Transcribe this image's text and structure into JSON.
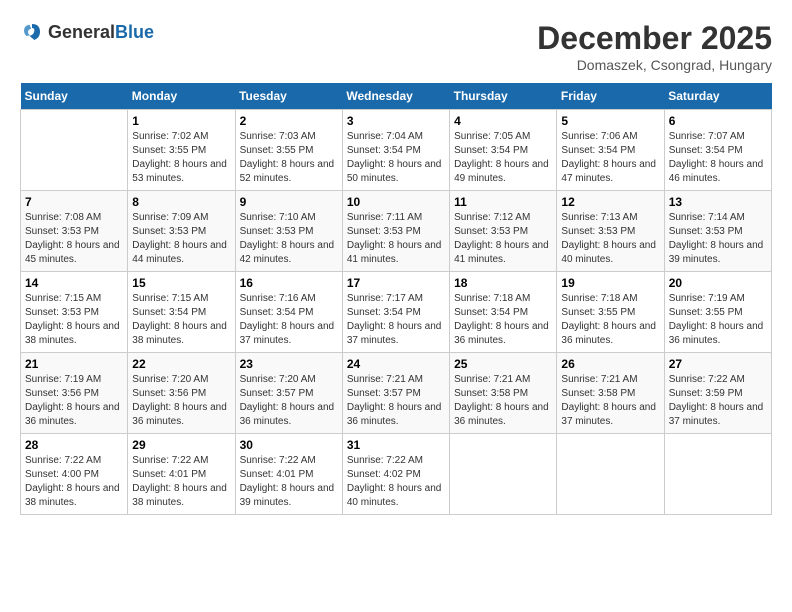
{
  "header": {
    "logo_general": "General",
    "logo_blue": "Blue",
    "month_title": "December 2025",
    "location": "Domaszek, Csongrad, Hungary"
  },
  "days_of_week": [
    "Sunday",
    "Monday",
    "Tuesday",
    "Wednesday",
    "Thursday",
    "Friday",
    "Saturday"
  ],
  "weeks": [
    [
      {
        "day": "",
        "sunrise": "",
        "sunset": "",
        "daylight": ""
      },
      {
        "day": "1",
        "sunrise": "Sunrise: 7:02 AM",
        "sunset": "Sunset: 3:55 PM",
        "daylight": "Daylight: 8 hours and 53 minutes."
      },
      {
        "day": "2",
        "sunrise": "Sunrise: 7:03 AM",
        "sunset": "Sunset: 3:55 PM",
        "daylight": "Daylight: 8 hours and 52 minutes."
      },
      {
        "day": "3",
        "sunrise": "Sunrise: 7:04 AM",
        "sunset": "Sunset: 3:54 PM",
        "daylight": "Daylight: 8 hours and 50 minutes."
      },
      {
        "day": "4",
        "sunrise": "Sunrise: 7:05 AM",
        "sunset": "Sunset: 3:54 PM",
        "daylight": "Daylight: 8 hours and 49 minutes."
      },
      {
        "day": "5",
        "sunrise": "Sunrise: 7:06 AM",
        "sunset": "Sunset: 3:54 PM",
        "daylight": "Daylight: 8 hours and 47 minutes."
      },
      {
        "day": "6",
        "sunrise": "Sunrise: 7:07 AM",
        "sunset": "Sunset: 3:54 PM",
        "daylight": "Daylight: 8 hours and 46 minutes."
      }
    ],
    [
      {
        "day": "7",
        "sunrise": "Sunrise: 7:08 AM",
        "sunset": "Sunset: 3:53 PM",
        "daylight": "Daylight: 8 hours and 45 minutes."
      },
      {
        "day": "8",
        "sunrise": "Sunrise: 7:09 AM",
        "sunset": "Sunset: 3:53 PM",
        "daylight": "Daylight: 8 hours and 44 minutes."
      },
      {
        "day": "9",
        "sunrise": "Sunrise: 7:10 AM",
        "sunset": "Sunset: 3:53 PM",
        "daylight": "Daylight: 8 hours and 42 minutes."
      },
      {
        "day": "10",
        "sunrise": "Sunrise: 7:11 AM",
        "sunset": "Sunset: 3:53 PM",
        "daylight": "Daylight: 8 hours and 41 minutes."
      },
      {
        "day": "11",
        "sunrise": "Sunrise: 7:12 AM",
        "sunset": "Sunset: 3:53 PM",
        "daylight": "Daylight: 8 hours and 41 minutes."
      },
      {
        "day": "12",
        "sunrise": "Sunrise: 7:13 AM",
        "sunset": "Sunset: 3:53 PM",
        "daylight": "Daylight: 8 hours and 40 minutes."
      },
      {
        "day": "13",
        "sunrise": "Sunrise: 7:14 AM",
        "sunset": "Sunset: 3:53 PM",
        "daylight": "Daylight: 8 hours and 39 minutes."
      }
    ],
    [
      {
        "day": "14",
        "sunrise": "Sunrise: 7:15 AM",
        "sunset": "Sunset: 3:53 PM",
        "daylight": "Daylight: 8 hours and 38 minutes."
      },
      {
        "day": "15",
        "sunrise": "Sunrise: 7:15 AM",
        "sunset": "Sunset: 3:54 PM",
        "daylight": "Daylight: 8 hours and 38 minutes."
      },
      {
        "day": "16",
        "sunrise": "Sunrise: 7:16 AM",
        "sunset": "Sunset: 3:54 PM",
        "daylight": "Daylight: 8 hours and 37 minutes."
      },
      {
        "day": "17",
        "sunrise": "Sunrise: 7:17 AM",
        "sunset": "Sunset: 3:54 PM",
        "daylight": "Daylight: 8 hours and 37 minutes."
      },
      {
        "day": "18",
        "sunrise": "Sunrise: 7:18 AM",
        "sunset": "Sunset: 3:54 PM",
        "daylight": "Daylight: 8 hours and 36 minutes."
      },
      {
        "day": "19",
        "sunrise": "Sunrise: 7:18 AM",
        "sunset": "Sunset: 3:55 PM",
        "daylight": "Daylight: 8 hours and 36 minutes."
      },
      {
        "day": "20",
        "sunrise": "Sunrise: 7:19 AM",
        "sunset": "Sunset: 3:55 PM",
        "daylight": "Daylight: 8 hours and 36 minutes."
      }
    ],
    [
      {
        "day": "21",
        "sunrise": "Sunrise: 7:19 AM",
        "sunset": "Sunset: 3:56 PM",
        "daylight": "Daylight: 8 hours and 36 minutes."
      },
      {
        "day": "22",
        "sunrise": "Sunrise: 7:20 AM",
        "sunset": "Sunset: 3:56 PM",
        "daylight": "Daylight: 8 hours and 36 minutes."
      },
      {
        "day": "23",
        "sunrise": "Sunrise: 7:20 AM",
        "sunset": "Sunset: 3:57 PM",
        "daylight": "Daylight: 8 hours and 36 minutes."
      },
      {
        "day": "24",
        "sunrise": "Sunrise: 7:21 AM",
        "sunset": "Sunset: 3:57 PM",
        "daylight": "Daylight: 8 hours and 36 minutes."
      },
      {
        "day": "25",
        "sunrise": "Sunrise: 7:21 AM",
        "sunset": "Sunset: 3:58 PM",
        "daylight": "Daylight: 8 hours and 36 minutes."
      },
      {
        "day": "26",
        "sunrise": "Sunrise: 7:21 AM",
        "sunset": "Sunset: 3:58 PM",
        "daylight": "Daylight: 8 hours and 37 minutes."
      },
      {
        "day": "27",
        "sunrise": "Sunrise: 7:22 AM",
        "sunset": "Sunset: 3:59 PM",
        "daylight": "Daylight: 8 hours and 37 minutes."
      }
    ],
    [
      {
        "day": "28",
        "sunrise": "Sunrise: 7:22 AM",
        "sunset": "Sunset: 4:00 PM",
        "daylight": "Daylight: 8 hours and 38 minutes."
      },
      {
        "day": "29",
        "sunrise": "Sunrise: 7:22 AM",
        "sunset": "Sunset: 4:01 PM",
        "daylight": "Daylight: 8 hours and 38 minutes."
      },
      {
        "day": "30",
        "sunrise": "Sunrise: 7:22 AM",
        "sunset": "Sunset: 4:01 PM",
        "daylight": "Daylight: 8 hours and 39 minutes."
      },
      {
        "day": "31",
        "sunrise": "Sunrise: 7:22 AM",
        "sunset": "Sunset: 4:02 PM",
        "daylight": "Daylight: 8 hours and 40 minutes."
      },
      {
        "day": "",
        "sunrise": "",
        "sunset": "",
        "daylight": ""
      },
      {
        "day": "",
        "sunrise": "",
        "sunset": "",
        "daylight": ""
      },
      {
        "day": "",
        "sunrise": "",
        "sunset": "",
        "daylight": ""
      }
    ]
  ]
}
